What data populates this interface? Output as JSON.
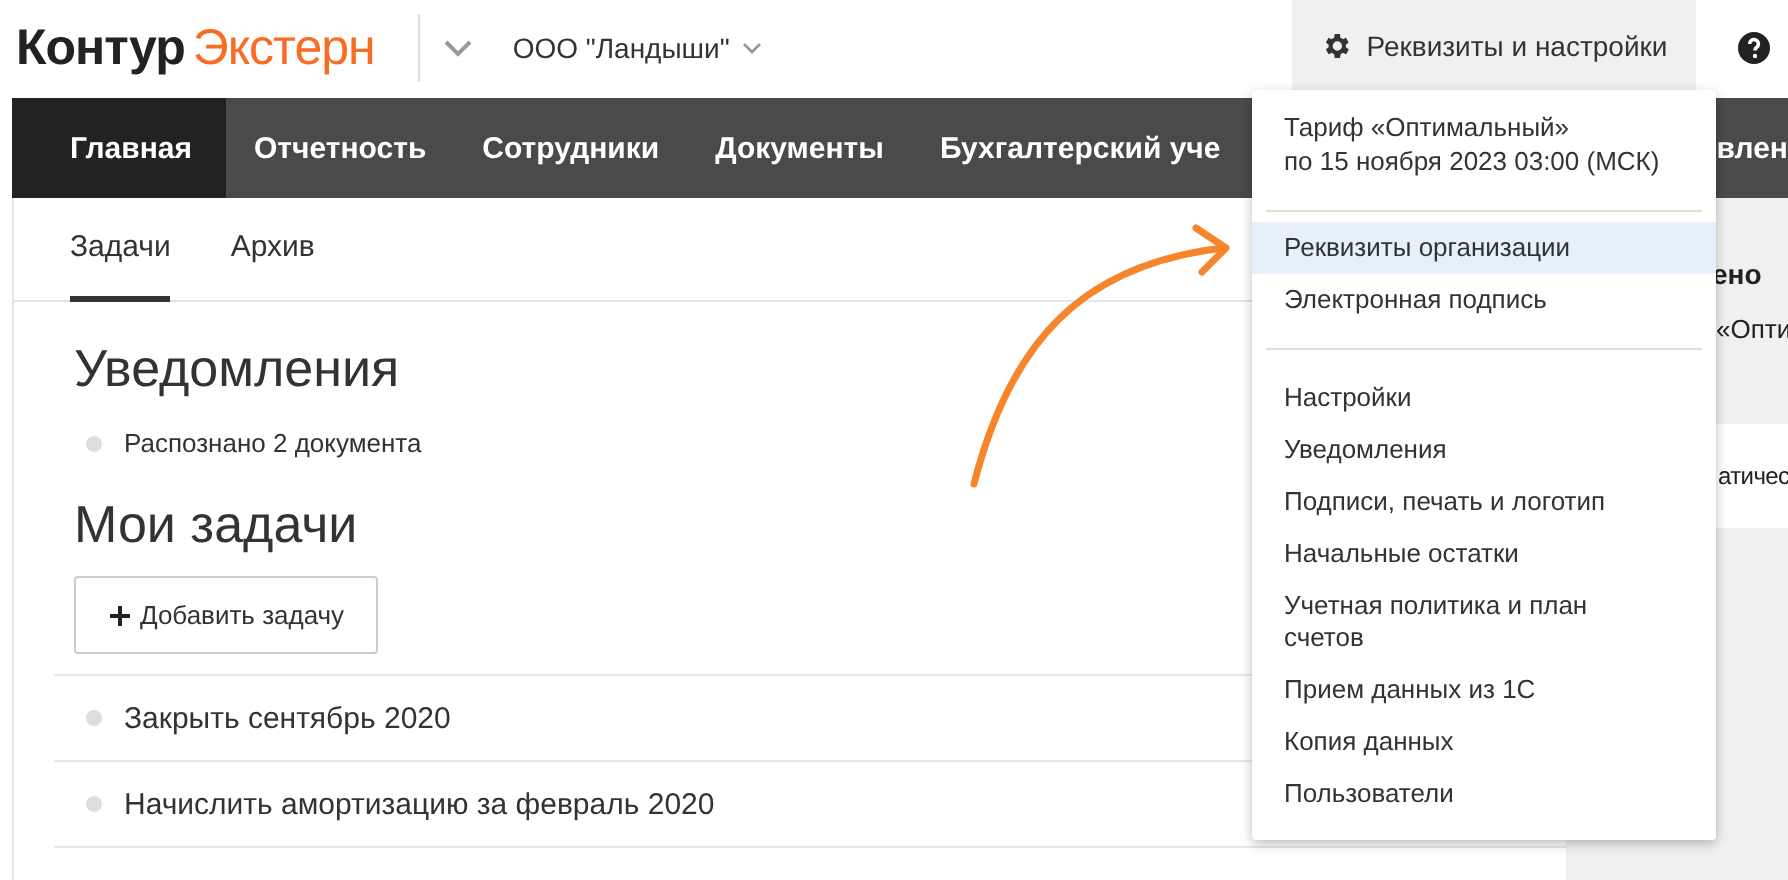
{
  "header": {
    "logo": {
      "part_1": "Контур",
      "part_2": "Экстерн"
    },
    "organization": "ООО \"Ландыши\"",
    "settings_button": "Реквизиты и настройки"
  },
  "nav": [
    {
      "label": "Главная",
      "selected": true
    },
    {
      "label": "Отчетность",
      "selected": false
    },
    {
      "label": "Сотрудники",
      "selected": false
    },
    {
      "label": "Документы",
      "selected": false
    },
    {
      "label": "Бухгалтерский уче",
      "selected": false
    },
    {
      "label": "влен",
      "selected": false
    }
  ],
  "tabs": [
    {
      "label": "Задачи",
      "selected": true
    },
    {
      "label": "Архив",
      "selected": false
    }
  ],
  "notifications": {
    "title": "Уведомления",
    "items": [
      "Распознано 2 документа"
    ]
  },
  "tasks": {
    "title": "Мои задачи",
    "add_button": "Добавить задачу",
    "items": [
      "Закрыть сентябрь 2020",
      "Начислить амортизацию за февраль 2020"
    ]
  },
  "side_panel": {
    "title": "ено",
    "text": "«Опти",
    "card_text": "атичес"
  },
  "menu": {
    "tariff": [
      "Тариф «Оптимальный»",
      "по 15 ноября 2023 03:00 (МСК)"
    ],
    "groups": [
      [
        {
          "label": "Реквизиты организации",
          "selected": true
        },
        {
          "label": "Электронная подпись",
          "selected": false
        }
      ],
      [
        {
          "label": "Настройки",
          "selected": false
        },
        {
          "label": "Уведомления",
          "selected": false
        },
        {
          "label": "Подписи, печать и логотип",
          "selected": false
        },
        {
          "label": "Начальные остатки",
          "selected": false
        },
        {
          "label": "Учетная политика и план счетов",
          "selected": false
        },
        {
          "label": "Прием данных из 1С",
          "selected": false
        },
        {
          "label": "Копия данных",
          "selected": false
        },
        {
          "label": "Пользователи",
          "selected": false
        }
      ]
    ]
  }
}
